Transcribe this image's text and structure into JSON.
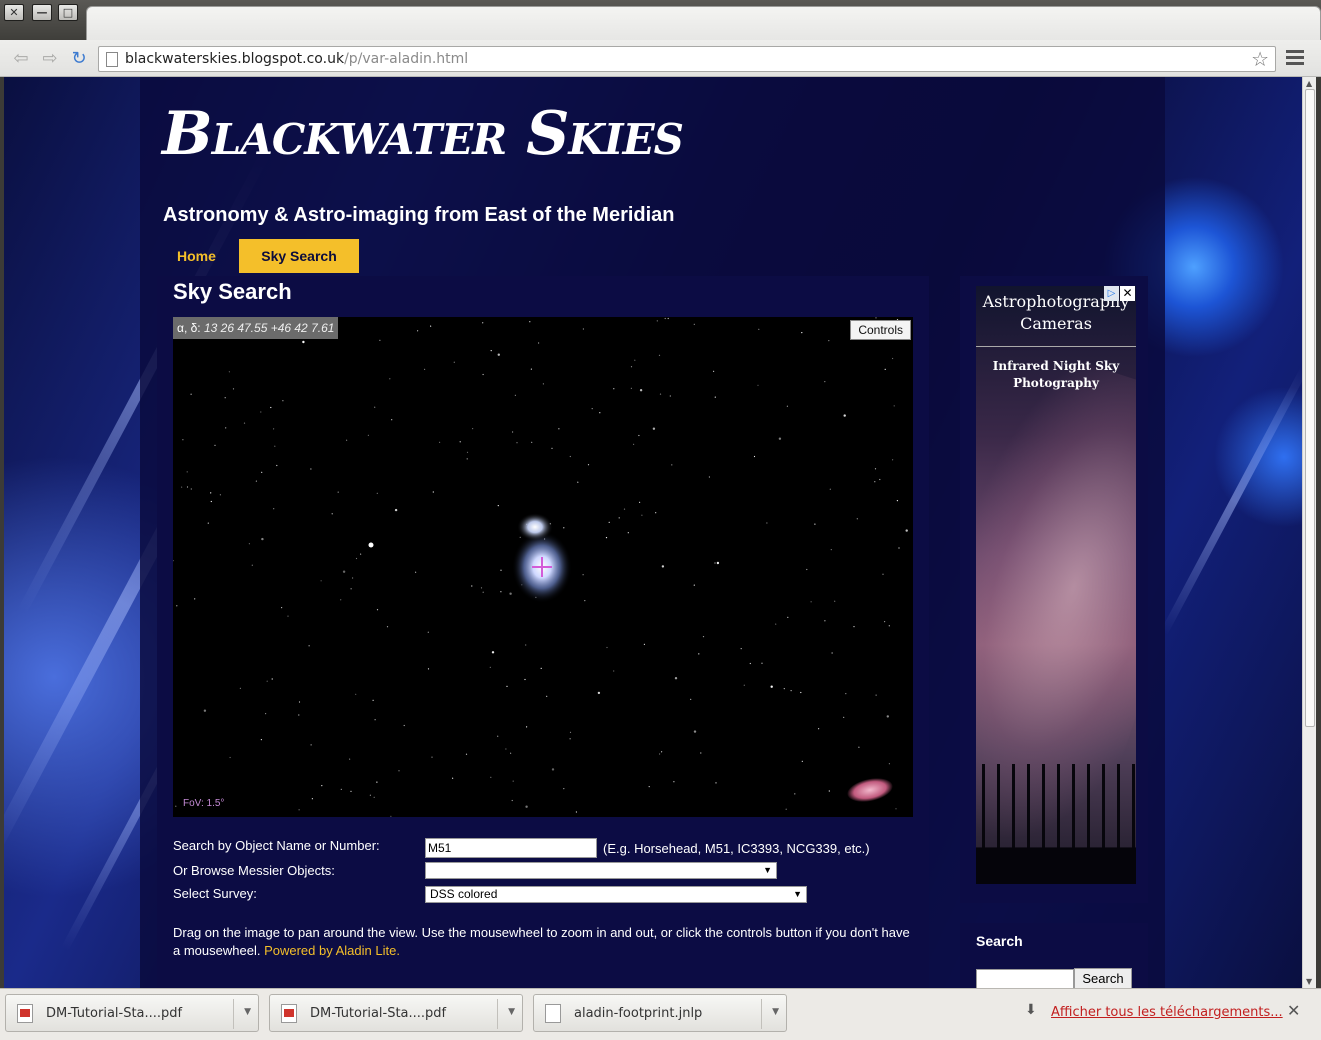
{
  "browser": {
    "window_buttons": [
      "✕",
      "—",
      "□"
    ],
    "url_host": "blackwaterskies.blogspot.co.uk",
    "url_path": "/p/var-aladin.html"
  },
  "blog": {
    "title": "Blackwater Skies",
    "description": "Astronomy & Astro-imaging from East of the Meridian",
    "nav": [
      {
        "label": "Home",
        "active": false
      },
      {
        "label": "Sky Search",
        "active": true
      }
    ]
  },
  "post": {
    "title": "Sky Search",
    "aladin": {
      "coords_label": "α, δ:",
      "coords_value": "13 26 47.55 +46 42 7.61",
      "controls_label": "Controls",
      "fov_label": "FoV: 1.5°"
    },
    "form": {
      "object_label": "Search by Object Name or Number:",
      "object_value": "M51",
      "object_hint": "(E.g. Horsehead, M51, IC3393, NCG339, etc.)",
      "messier_label": "Or Browse Messier Objects:",
      "messier_value": "",
      "survey_label": "Select Survey:",
      "survey_value": "DSS colored"
    },
    "help_text": "Drag on the image to pan around the view. Use the mousewheel to zoom in and out, or click the controls button if you don't have a mousewheel.",
    "help_link": "Powered by Aladin Lite."
  },
  "sidebar": {
    "ad": {
      "title": "Astrophotography Cameras",
      "subtitle": "Infrared Night Sky Photography",
      "choice_icon": "▷",
      "close_icon": "✕"
    },
    "search": {
      "title": "Search",
      "button": "Search"
    }
  },
  "downloads": {
    "items": [
      {
        "name": "DM-Tutorial-Sta....pdf",
        "icon": "pdf-icon"
      },
      {
        "name": "DM-Tutorial-Sta....pdf",
        "icon": "pdf-icon"
      },
      {
        "name": "aladin-footprint.jnlp",
        "icon": "file-icon"
      }
    ],
    "show_all": "Afficher tous les téléchargements..."
  }
}
